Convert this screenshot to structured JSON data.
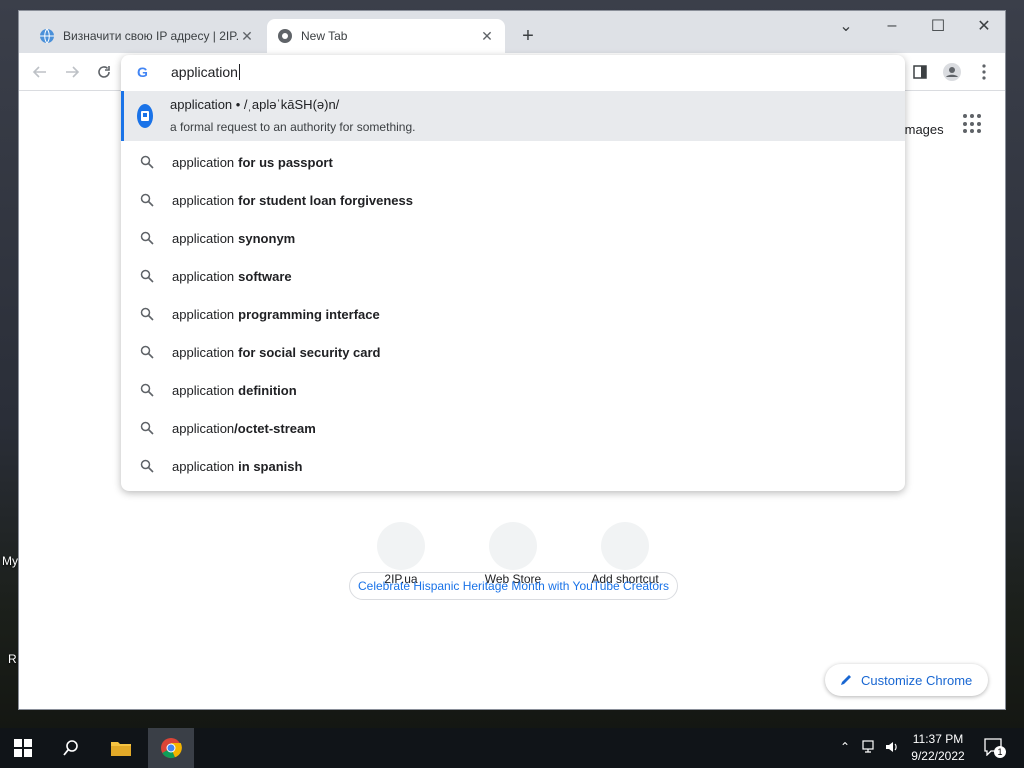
{
  "desktop": {
    "label_1": "My",
    "label_2": "R"
  },
  "tabs": [
    {
      "title": "Визначити свою IP адресу | 2IP.ua",
      "active": false
    },
    {
      "title": "New Tab",
      "active": true
    }
  ],
  "window_controls": {
    "menu": "⌄",
    "minimize": "–",
    "maximize": "☐",
    "close": "✕"
  },
  "omnibox": {
    "query": "application",
    "answer": {
      "line1": "application • /ˌapləˈkāSH(ə)n/",
      "line2": "a formal request to an authority for something."
    },
    "suggestions": [
      {
        "prefix": "application",
        "suffix": "for us passport",
        "tight": false
      },
      {
        "prefix": "application",
        "suffix": "for student loan forgiveness",
        "tight": false
      },
      {
        "prefix": "application",
        "suffix": "synonym",
        "tight": false
      },
      {
        "prefix": "application",
        "suffix": "software",
        "tight": false
      },
      {
        "prefix": "application",
        "suffix": "programming interface",
        "tight": false
      },
      {
        "prefix": "application",
        "suffix": "for social security card",
        "tight": false
      },
      {
        "prefix": "application",
        "suffix": "definition",
        "tight": false
      },
      {
        "prefix": "application",
        "suffix": "/octet-stream",
        "tight": true
      },
      {
        "prefix": "application",
        "suffix": "in spanish",
        "tight": false
      }
    ]
  },
  "page": {
    "images_link": "Images",
    "shortcuts": [
      {
        "label": "2IP.ua"
      },
      {
        "label": "Web Store"
      },
      {
        "label": "Add shortcut"
      }
    ],
    "celebrate_chip": "Celebrate Hispanic Heritage Month with YouTube Creators",
    "customize_button": "Customize Chrome"
  },
  "taskbar": {
    "time": "11:37 PM",
    "date": "9/22/2022",
    "notification_count": "1"
  },
  "colors": {
    "accent": "#1a73e8",
    "taskbar": "#101418"
  }
}
